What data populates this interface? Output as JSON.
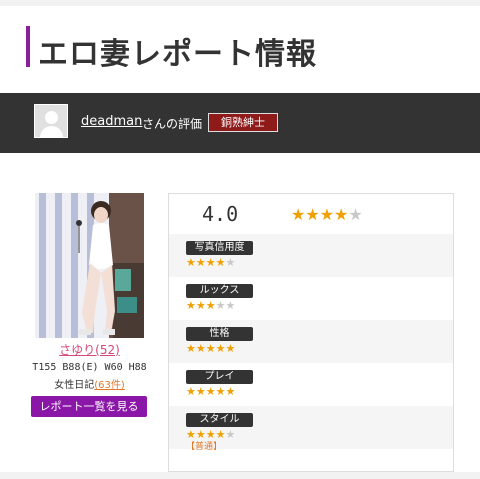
{
  "header": {
    "title": "エロ妻レポート情報",
    "accent_color": "#8a1d9a"
  },
  "reviewer": {
    "avatar_icon": "user-avatar-icon",
    "username": "deadman",
    "suffix": "さんの評価",
    "rank": "銅熟紳士",
    "rank_color": "#8e1a1a"
  },
  "girl": {
    "name": "さゆり(52)",
    "measurements": "T155 B88(E) W60 H88",
    "diary_label": "女性日記",
    "diary_count": "(63件)",
    "report_button": "レポート一覧を見る",
    "button_color": "#8a17a8"
  },
  "rating": {
    "overall": "4.0",
    "overall_stars": 4,
    "max_stars": 5,
    "star_color": "#f0a000",
    "categories": [
      {
        "label": "写真信用度",
        "stars": 4,
        "note": ""
      },
      {
        "label": "ルックス",
        "stars": 3,
        "note": ""
      },
      {
        "label": "性格",
        "stars": 5,
        "note": ""
      },
      {
        "label": "プレイ",
        "stars": 5,
        "note": ""
      },
      {
        "label": "スタイル",
        "stars": 4,
        "note": "【普通】"
      }
    ]
  }
}
